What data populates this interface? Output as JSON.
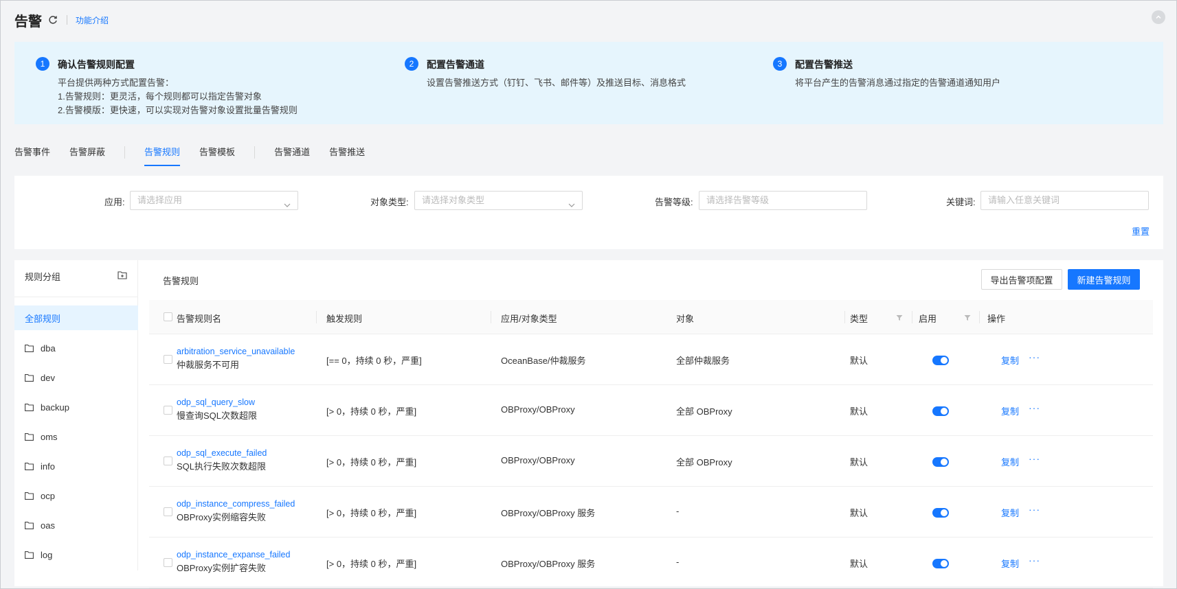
{
  "header": {
    "title": "告警",
    "intro_link": "功能介绍"
  },
  "banner": {
    "steps": [
      {
        "num": "1",
        "title": "确认告警规则配置",
        "lines": [
          "平台提供两种方式配置告警：",
          "1.告警规则：更灵活，每个规则都可以指定告警对象",
          "2.告警模版：更快速，可以实现对告警对象设置批量告警规则"
        ]
      },
      {
        "num": "2",
        "title": "配置告警通道",
        "lines": [
          "设置告警推送方式（钉钉、飞书、邮件等）及推送目标、消息格式"
        ]
      },
      {
        "num": "3",
        "title": "配置告警推送",
        "lines": [
          "将平台产生的告警消息通过指定的告警通道通知用户"
        ]
      }
    ]
  },
  "tabs": [
    "告警事件",
    "告警屏蔽",
    "告警规则",
    "告警模板",
    "告警通道",
    "告警推送"
  ],
  "active_tab": "告警规则",
  "filters": {
    "app_label": "应用:",
    "app_placeholder": "请选择应用",
    "objtype_label": "对象类型:",
    "objtype_placeholder": "请选择对象类型",
    "level_label": "告警等级:",
    "level_placeholder": "请选择告警等级",
    "keyword_label": "关键词:",
    "keyword_placeholder": "请输入任意关键词",
    "reset": "重置"
  },
  "sidebar": {
    "title": "规则分组",
    "items": [
      "全部规则",
      "dba",
      "dev",
      "backup",
      "oms",
      "info",
      "ocp",
      "oas",
      "log"
    ]
  },
  "content": {
    "title": "告警规则",
    "export_button": "导出告警项配置",
    "new_button": "新建告警规则"
  },
  "table": {
    "columns": [
      "告警规则名",
      "触发规则",
      "应用/对象类型",
      "对象",
      "类型",
      "启用",
      "操作"
    ],
    "rows": [
      {
        "name_en": "arbitration_service_unavailable",
        "name_cn": "仲裁服务不可用",
        "trigger": "[== 0，持续 0 秒，严重]",
        "app": "OceanBase/仲裁服务",
        "object": "全部仲裁服务",
        "type": "默认",
        "enabled": true,
        "action": "复制",
        "more": "···"
      },
      {
        "name_en": "odp_sql_query_slow",
        "name_cn": "慢查询SQL次数超限",
        "trigger": "[> 0，持续 0 秒，严重]",
        "app": "OBProxy/OBProxy",
        "object": "全部 OBProxy",
        "type": "默认",
        "enabled": true,
        "action": "复制",
        "more": "···"
      },
      {
        "name_en": "odp_sql_execute_failed",
        "name_cn": "SQL执行失败次数超限",
        "trigger": "[> 0，持续 0 秒，严重]",
        "app": "OBProxy/OBProxy",
        "object": "全部 OBProxy",
        "type": "默认",
        "enabled": true,
        "action": "复制",
        "more": "···"
      },
      {
        "name_en": "odp_instance_compress_failed",
        "name_cn": "OBProxy实例缩容失败",
        "trigger": "[> 0，持续 0 秒，严重]",
        "app": "OBProxy/OBProxy 服务",
        "object": "-",
        "type": "默认",
        "enabled": true,
        "action": "复制",
        "more": "···"
      },
      {
        "name_en": "odp_instance_expanse_failed",
        "name_cn": "OBProxy实例扩容失败",
        "trigger": "[> 0，持续 0 秒，严重]",
        "app": "OBProxy/OBProxy 服务",
        "object": "-",
        "type": "默认",
        "enabled": true,
        "action": "复制",
        "more": "···"
      }
    ]
  },
  "colors": {
    "accent": "#1677ff",
    "banner_bg": "#e6f5fd"
  }
}
